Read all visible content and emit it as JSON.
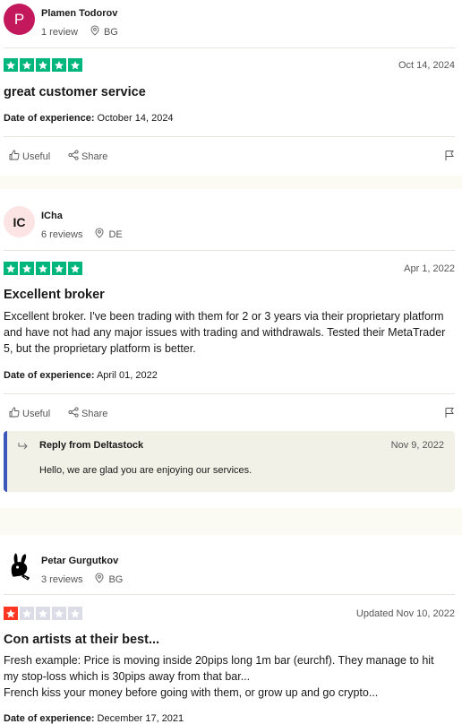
{
  "colors": {
    "star_green": "#00b67a",
    "star_red": "#ff3722",
    "star_grey": "#dcdce6",
    "reply_accent": "#3c57bc",
    "avatar_p": "#c3185b",
    "avatar_ic": "#fde4e4",
    "page_bg": "#fcfbf3"
  },
  "reviews": [
    {
      "avatar_text": "P",
      "name": "Plamen Todorov",
      "review_count": "1 review",
      "country": "BG",
      "rating": 5,
      "date": "Oct 14, 2024",
      "title": "great customer service",
      "body": "",
      "experience_label": "Date of experience:",
      "experience_date": "October 14, 2024",
      "useful_label": "Useful",
      "share_label": "Share"
    },
    {
      "avatar_text": "IC",
      "name": "ICha",
      "review_count": "6 reviews",
      "country": "DE",
      "rating": 5,
      "date": "Apr 1, 2022",
      "title": "Excellent broker",
      "body": "Excellent broker. I've been trading with them for 2 or 3 years via their proprietary platform and have not had any major issues with trading and withdrawals. Tested their MetaTrader 5, but the proprietary platform is better.",
      "experience_label": "Date of experience:",
      "experience_date": "April 01, 2022",
      "useful_label": "Useful",
      "share_label": "Share",
      "reply": {
        "title": "Reply from Deltastock",
        "date": "Nov 9, 2022",
        "text": "Hello, we are glad you are enjoying our services."
      }
    },
    {
      "avatar_text": "",
      "avatar_icon": "playboy-bunny-avatar",
      "name": "Petar Gurgutkov",
      "review_count": "3 reviews",
      "country": "BG",
      "rating": 1,
      "date": "Updated Nov 10, 2022",
      "title": "Con artists at their best...",
      "body_lines": [
        "Fresh example: Price is moving inside 20pips long 1m bar (eurchf). They manage to hit my stop-loss which is 30pips away from that bar...",
        "French kiss your money before going with them, or grow up and go crypto..."
      ],
      "experience_label": "Date of experience:",
      "experience_date": "December 17, 2021"
    }
  ]
}
